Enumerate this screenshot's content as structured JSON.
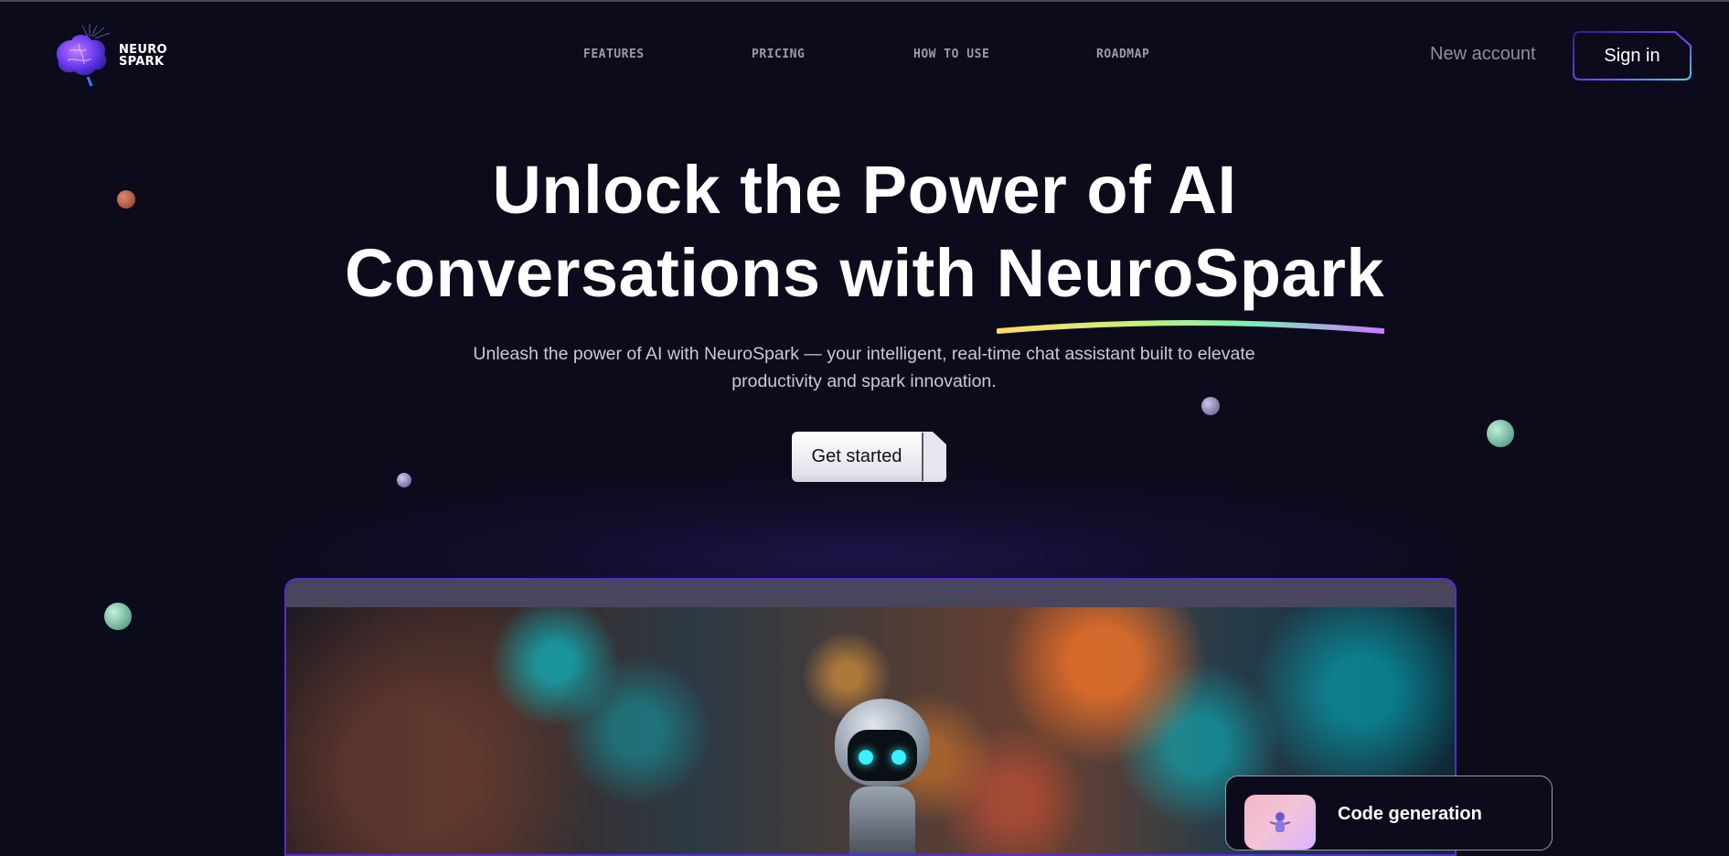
{
  "brand": {
    "name_line1": "NEURO",
    "name_line2": "SPARK",
    "logo_icon": "brain-icon",
    "accent": "#6b3cf0"
  },
  "nav": {
    "items": [
      "FEATURES",
      "PRICING",
      "HOW TO USE",
      "ROADMAP"
    ]
  },
  "auth": {
    "new_account": "New account",
    "sign_in": "Sign in"
  },
  "hero": {
    "title_line1": "Unlock the Power of AI",
    "title_line2_prefix": "Conversations with ",
    "title_highlight": "NeuroSpark",
    "subtitle": "Unleash the power of AI with NeuroSpark — your intelligent, real-time chat assistant built to elevate productivity and spark innovation.",
    "cta": "Get started"
  },
  "showcase": {
    "image": "robot-in-neon-city-street"
  },
  "feature_card": {
    "title": "Code generation",
    "icon": "robot-icon"
  },
  "colors": {
    "background": "#0c0b1b",
    "frame_border": "#5a2bd1",
    "nav_text": "#9b9ba6"
  }
}
